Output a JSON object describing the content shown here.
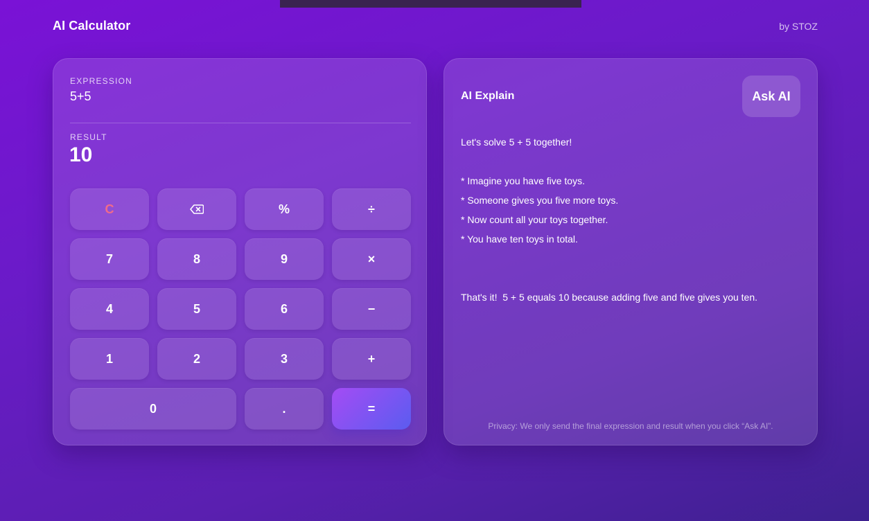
{
  "header": {
    "title": "AI Calculator",
    "byline": "by STOZ"
  },
  "calculator": {
    "expression_label": "EXPRESSION",
    "expression": "5+5",
    "result_label": "RESULT",
    "result": "10",
    "keys": {
      "clear": "C",
      "backspace": "backspace-icon",
      "percent": "%",
      "divide": "÷",
      "seven": "7",
      "eight": "8",
      "nine": "9",
      "multiply": "×",
      "four": "4",
      "five": "5",
      "six": "6",
      "minus": "−",
      "one": "1",
      "two": "2",
      "three": "3",
      "plus": "+",
      "zero": "0",
      "decimal": ".",
      "equals": "="
    },
    "colors": {
      "clear": "#f06b8a",
      "equals_start": "#a44cf4",
      "equals_end": "#5b5cf0"
    }
  },
  "ai_panel": {
    "title": "AI Explain",
    "ask_button": "Ask AI",
    "explanation": [
      "Let's solve 5 + 5 together!",
      "",
      "* Imagine you have five toys.",
      "* Someone gives you five more toys.",
      "* Now count all your toys together.",
      "* You have ten toys in total.",
      "",
      "",
      "That's it!  5 + 5 equals 10 because adding five and five gives you ten."
    ],
    "privacy": "Privacy: We only send the final expression and result when you click “Ask AI”."
  }
}
